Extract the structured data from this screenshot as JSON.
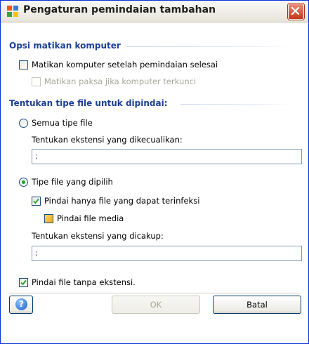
{
  "window": {
    "title": "Pengaturan pemindaian tambahan"
  },
  "section_shutdown": {
    "heading": "Opsi matikan komputer",
    "shutdown_after_scan": {
      "label": "Matikan komputer setelah pemindaian selesai",
      "checked": false
    },
    "force_shutdown": {
      "label": "Matikan paksa jika komputer terkunci",
      "checked": false,
      "enabled": false
    }
  },
  "section_filetypes": {
    "heading": "Tentukan tipe file untuk dipindai:",
    "all_types": {
      "label": "Semua tipe file",
      "selected": false
    },
    "excluded_extensions": {
      "label": "Tentukan ekstensi yang dikecualikan:",
      "value": ";"
    },
    "selected_types": {
      "label": "Tipe file yang dipilih",
      "selected": true
    },
    "infectable_only": {
      "label": "Pindai hanya file yang dapat terinfeksi",
      "checked": true
    },
    "media_files": {
      "label": "Pindai file media",
      "state": "indeterminate"
    },
    "included_extensions": {
      "label": "Tentukan ekstensi yang dicakup:",
      "value": ";"
    },
    "no_extension": {
      "label": "Pindai file tanpa ekstensi.",
      "checked": true
    }
  },
  "buttons": {
    "help_icon": "question-icon",
    "ok": "OK",
    "cancel": "Batal"
  },
  "colors": {
    "heading": "#1c3f94",
    "check_mark": "#21a121"
  }
}
